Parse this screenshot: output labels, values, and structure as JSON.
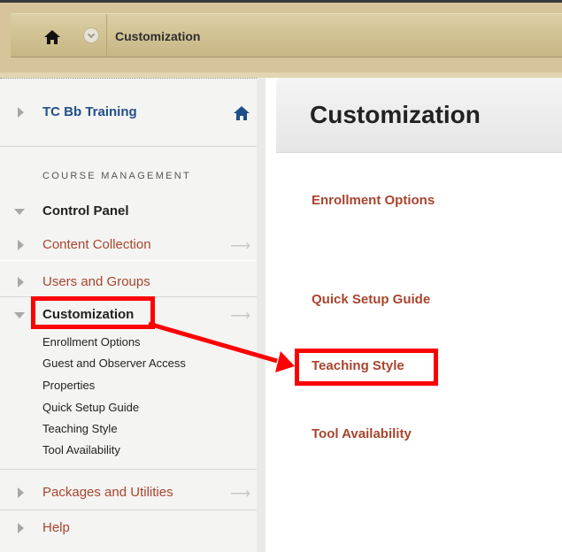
{
  "breadcrumb": {
    "label": "Customization"
  },
  "sidebar": {
    "course_title": "TC Bb Training",
    "section_header": "COURSE MANAGEMENT",
    "items": [
      {
        "label": "Control Panel"
      },
      {
        "label": "Content Collection"
      },
      {
        "label": "Users and Groups"
      },
      {
        "label": "Customization"
      },
      {
        "label": "Packages and Utilities"
      },
      {
        "label": "Help"
      }
    ],
    "sub_items": [
      "Enrollment Options",
      "Guest and Observer Access",
      "Properties",
      "Quick Setup Guide",
      "Teaching Style",
      "Tool Availability"
    ]
  },
  "content": {
    "title": "Customization",
    "links": [
      "Enrollment Options",
      "Quick Setup Guide",
      "Teaching Style",
      "Tool Availability"
    ]
  },
  "colors": {
    "accent": "#a8452e",
    "breadcrumb_bar": "#d8c49a",
    "highlight": "#ff0000",
    "course_title": "#1f4f8a"
  },
  "icons": [
    "home-icon",
    "menu-chevron-icon",
    "expand-triangle-icon",
    "collapse-triangle-icon",
    "arrow-right-icon"
  ]
}
